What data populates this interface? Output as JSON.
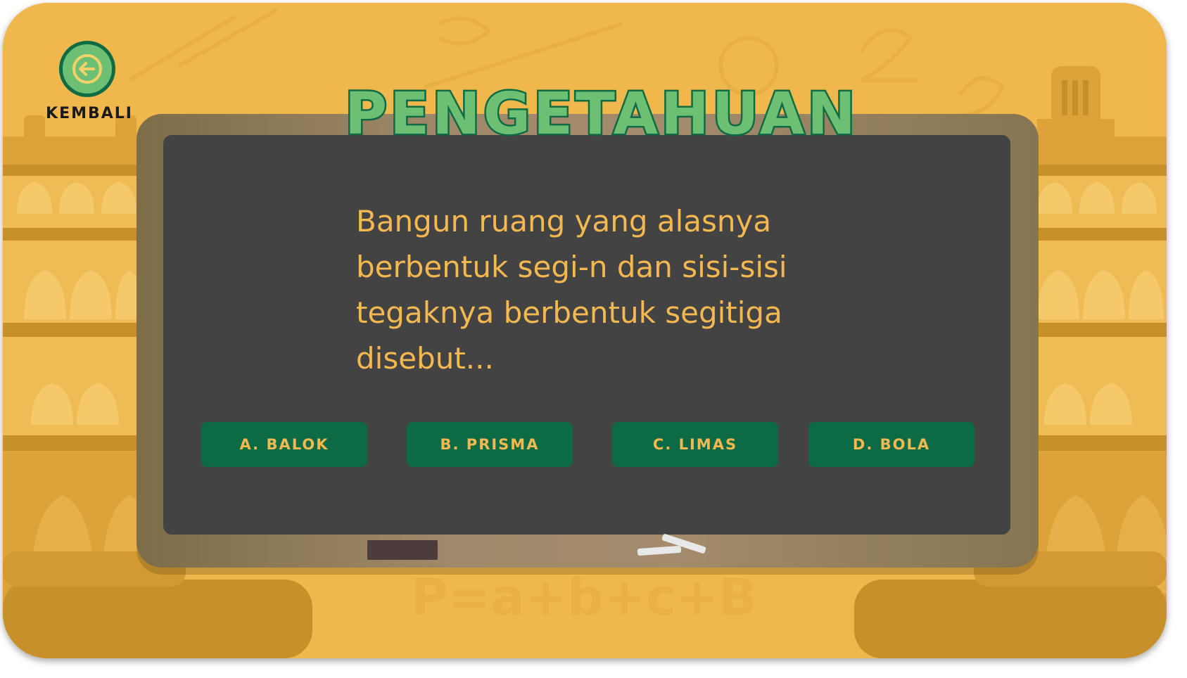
{
  "back": {
    "label": "KEMBALI",
    "icon": "arrow-left-icon"
  },
  "title": "PENGETAHUAN",
  "question": "Bangun ruang yang alasnya berbentuk segi-n dan sisi-sisi tegaknya berbentuk segitiga disebut...",
  "answers": [
    {
      "label": "A. BALOK"
    },
    {
      "label": "B. PRISMA"
    },
    {
      "label": "C. LIMAS"
    },
    {
      "label": "D. BOLA"
    }
  ],
  "background_formula": "P=a+b+c+B",
  "colors": {
    "background": "#f0b84c",
    "building": "#e0a43a",
    "building_dark": "#c8902a",
    "board_frame": "#a0896a",
    "chalkboard": "#434343",
    "accent_green": "#6dbf73",
    "dark_green": "#0e6b44",
    "text_yellow": "#f3b850"
  }
}
